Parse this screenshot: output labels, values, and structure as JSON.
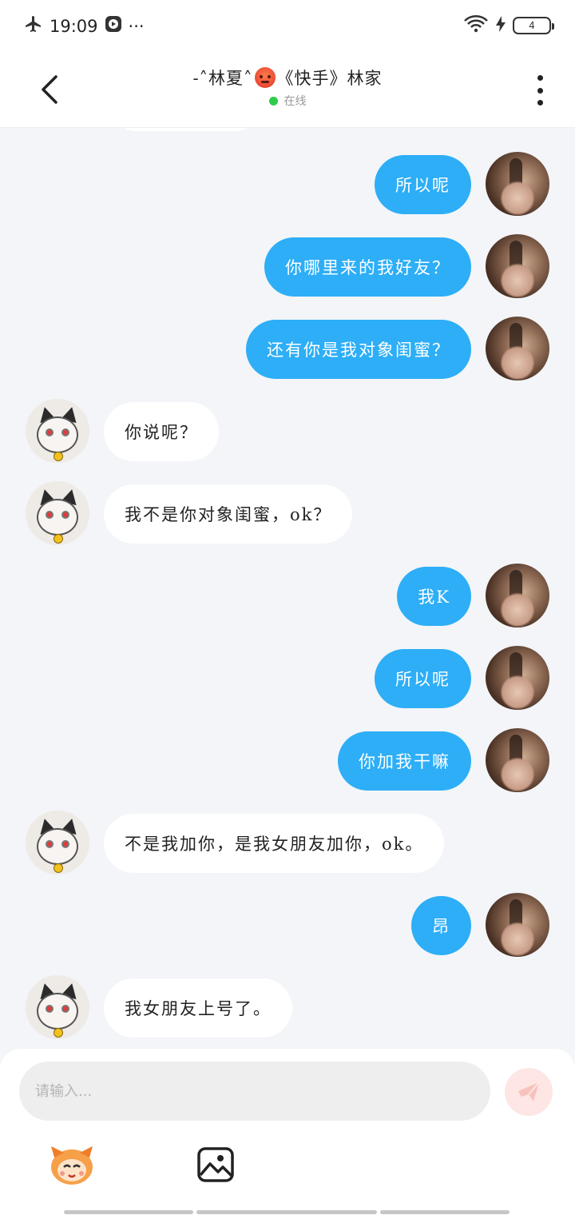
{
  "status_bar": {
    "time": "19:09",
    "more_indicator": "···",
    "battery_level": "4",
    "icons": [
      "airplane-mode-icon",
      "media-app-icon",
      "wifi-icon",
      "charging-icon",
      "battery-icon"
    ]
  },
  "header": {
    "title_prefix": "-˄林夏˄",
    "title_suffix": "《快手》林家",
    "title_emoji": "angry-face-emoji",
    "status_text": "在线",
    "status_color": "#2fcc4a"
  },
  "colors": {
    "outgoing_bubble": "#2daef7",
    "incoming_bubble": "#ffffff",
    "background": "#f3f5f8"
  },
  "messages": [
    {
      "direction": "out",
      "text": "所以呢"
    },
    {
      "direction": "out",
      "text": "你哪里来的我好友？"
    },
    {
      "direction": "out",
      "text": "还有你是我对象闺蜜？"
    },
    {
      "direction": "in",
      "text": "你说呢？"
    },
    {
      "direction": "in",
      "text": "我不是你对象闺蜜，ok？"
    },
    {
      "direction": "out",
      "text": "我K"
    },
    {
      "direction": "out",
      "text": "所以呢"
    },
    {
      "direction": "out",
      "text": "你加我干嘛"
    },
    {
      "direction": "in",
      "text": "不是我加你，是我女朋友加你，ok。"
    },
    {
      "direction": "out",
      "text": "昂"
    },
    {
      "direction": "in",
      "text": "我女朋友上号了。"
    }
  ],
  "composer": {
    "placeholder": "请输入...",
    "value": ""
  }
}
